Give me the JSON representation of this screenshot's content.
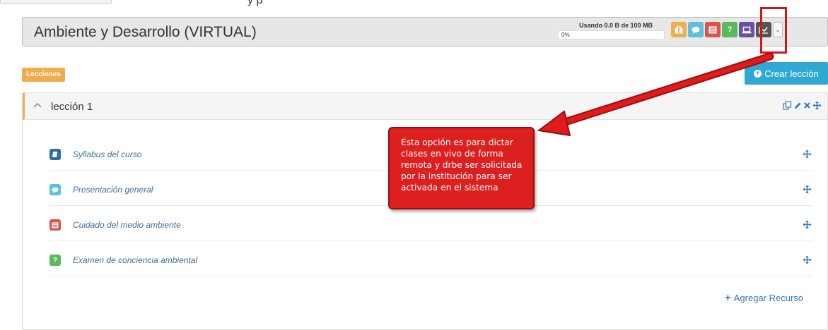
{
  "top": {
    "glyph": "y p"
  },
  "course": {
    "title": "Ambiente y Desarrollo (VIRTUAL)"
  },
  "storage": {
    "label": "Usando 0.0 B de 100 MB",
    "percent_text": "0%",
    "percent": 0
  },
  "toolbar": {
    "tools": [
      {
        "icon": "briefcase-icon",
        "color": "#f0ad4e"
      },
      {
        "icon": "chat-bubble-icon",
        "color": "#5bc0de"
      },
      {
        "icon": "list-document-icon",
        "color": "#d9534f"
      },
      {
        "icon": "question-icon",
        "color": "#5cb85c"
      },
      {
        "icon": "laptop-icon",
        "color": "#6b4fa3"
      },
      {
        "icon": "line-chart-icon",
        "color": "#555555"
      }
    ],
    "question_glyph": "?",
    "dropdown_glyph": "⌄"
  },
  "lessons": {
    "badge": "Lecciones",
    "create_label": "Crear lección",
    "lesson": {
      "title": "lección 1",
      "resources": [
        {
          "label": "Syllabus del curso",
          "icon": "book-icon",
          "color": "#2e6da4"
        },
        {
          "label": "Presentación general",
          "icon": "chat-bubble-icon",
          "color": "#5bc0de"
        },
        {
          "label": "Cuidado del medio ambiente",
          "icon": "list-document-icon",
          "color": "#d9534f"
        },
        {
          "label": "Examen de conciencia ambiental",
          "icon": "question-icon",
          "color": "#5cb85c",
          "glyph": "?"
        }
      ],
      "add_resource_label": "Agregar Recurso"
    }
  },
  "annotation": {
    "text": "Ésta opción es para dictar clases en vivo de forma remota y drbe ser solicitada por la institución para ser activada en el sistema"
  }
}
